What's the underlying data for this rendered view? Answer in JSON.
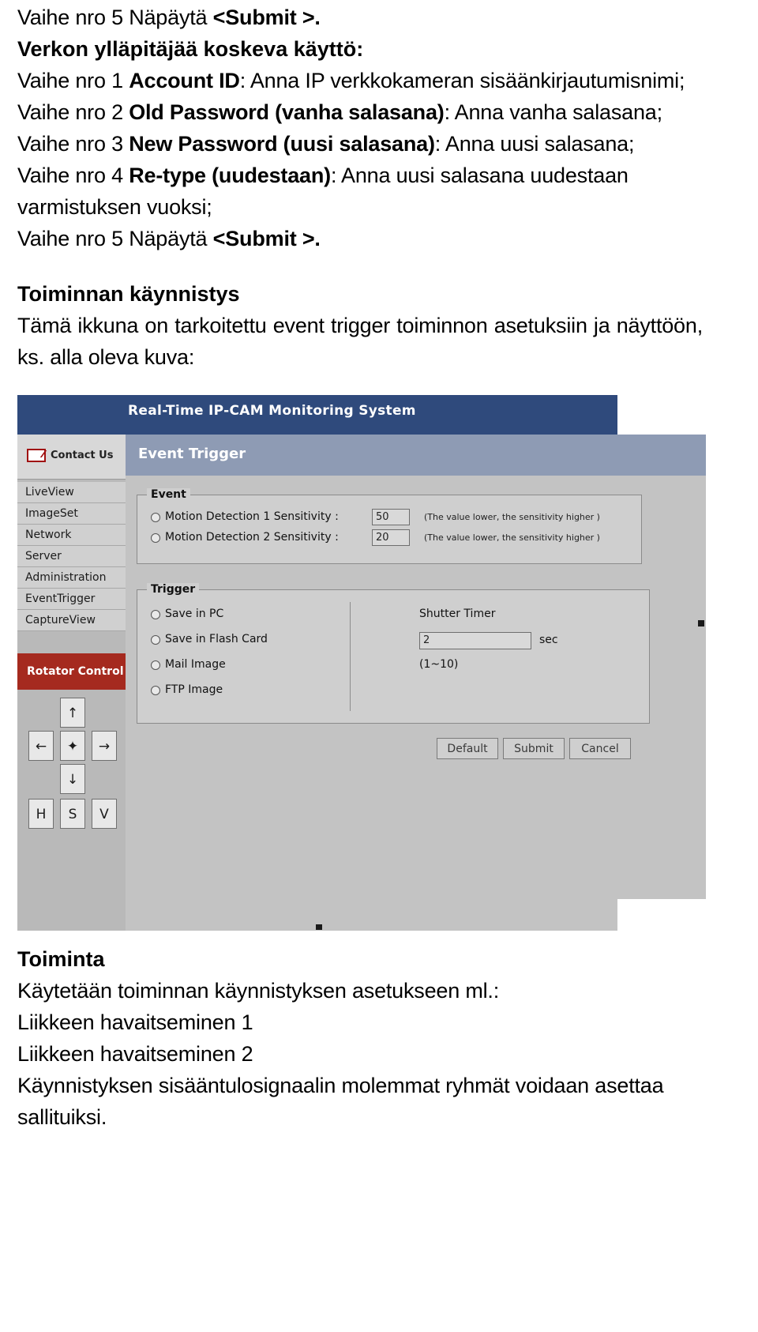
{
  "document": {
    "line_top": {
      "prefix": "Vaihe nro 5 Näpäytä ",
      "bold": "<Submit >."
    },
    "section_admin": {
      "heading": "Verkon ylläpitäjää koskeva käyttö:",
      "steps": [
        {
          "pre": "Vaihe nro 1 ",
          "bold": "Account ID",
          "post": ": Anna IP verkkokameran sisäänkirjautumisnimi;"
        },
        {
          "pre": "Vaihe nro 2 ",
          "bold": "Old Password (vanha salasana)",
          "post": ": Anna vanha salasana;"
        },
        {
          "pre": "Vaihe nro 3 ",
          "bold": "New Password (uusi salasana)",
          "post": ": Anna uusi salasana;"
        },
        {
          "pre": "Vaihe nro 4 ",
          "bold": "Re-type (uudestaan)",
          "post": ": Anna uusi salasana uudestaan varmistuksen vuoksi;"
        },
        {
          "pre": "Vaihe nro 5 Näpäytä ",
          "bold": "<Submit >.",
          "post": ""
        }
      ]
    },
    "section_trigger": {
      "heading": "Toiminnan käynnistys",
      "body": "Tämä ikkuna on tarkoitettu event trigger toiminnon asetuksiin ja näyttöön, ks. alla oleva kuva:"
    },
    "section_action": {
      "heading": "Toiminta",
      "lines": [
        "Käytetään toiminnan käynnistyksen asetukseen ml.:",
        "Liikkeen havaitseminen 1",
        "Liikkeen havaitseminen 2",
        "Käynnistyksen sisääntulosignaalin molemmat ryhmät voidaan asettaa sallituiksi."
      ]
    }
  },
  "figure": {
    "window_title": "Real-Time IP-CAM Monitoring System",
    "contact_label": "Contact Us",
    "nav_items": [
      "LiveView",
      "ImageSet",
      "Network",
      "Server",
      "Administration",
      "EventTrigger",
      "CaptureView"
    ],
    "rotator_label": "Rotator Control",
    "pad_buttons": [
      "↑",
      "←",
      "✦",
      "→",
      "↓",
      "H",
      "S",
      "V"
    ],
    "panel_title": "Event Trigger",
    "event_group": {
      "title": "Event",
      "rows": [
        {
          "label": "Motion Detection 1 Sensitivity :",
          "value": "50",
          "hint": "(The value lower, the sensitivity higher )"
        },
        {
          "label": "Motion Detection 2 Sensitivity :",
          "value": "20",
          "hint": "(The value lower, the sensitivity higher )"
        }
      ]
    },
    "trigger_group": {
      "title": "Trigger",
      "options": [
        "Save in PC",
        "Save in Flash Card",
        "Mail Image",
        "FTP Image"
      ],
      "shutter_label": "Shutter Timer",
      "shutter_value": "2",
      "shutter_unit": "sec",
      "shutter_range": "(1~10)"
    },
    "buttons": [
      "Default",
      "Submit",
      "Cancel"
    ]
  }
}
